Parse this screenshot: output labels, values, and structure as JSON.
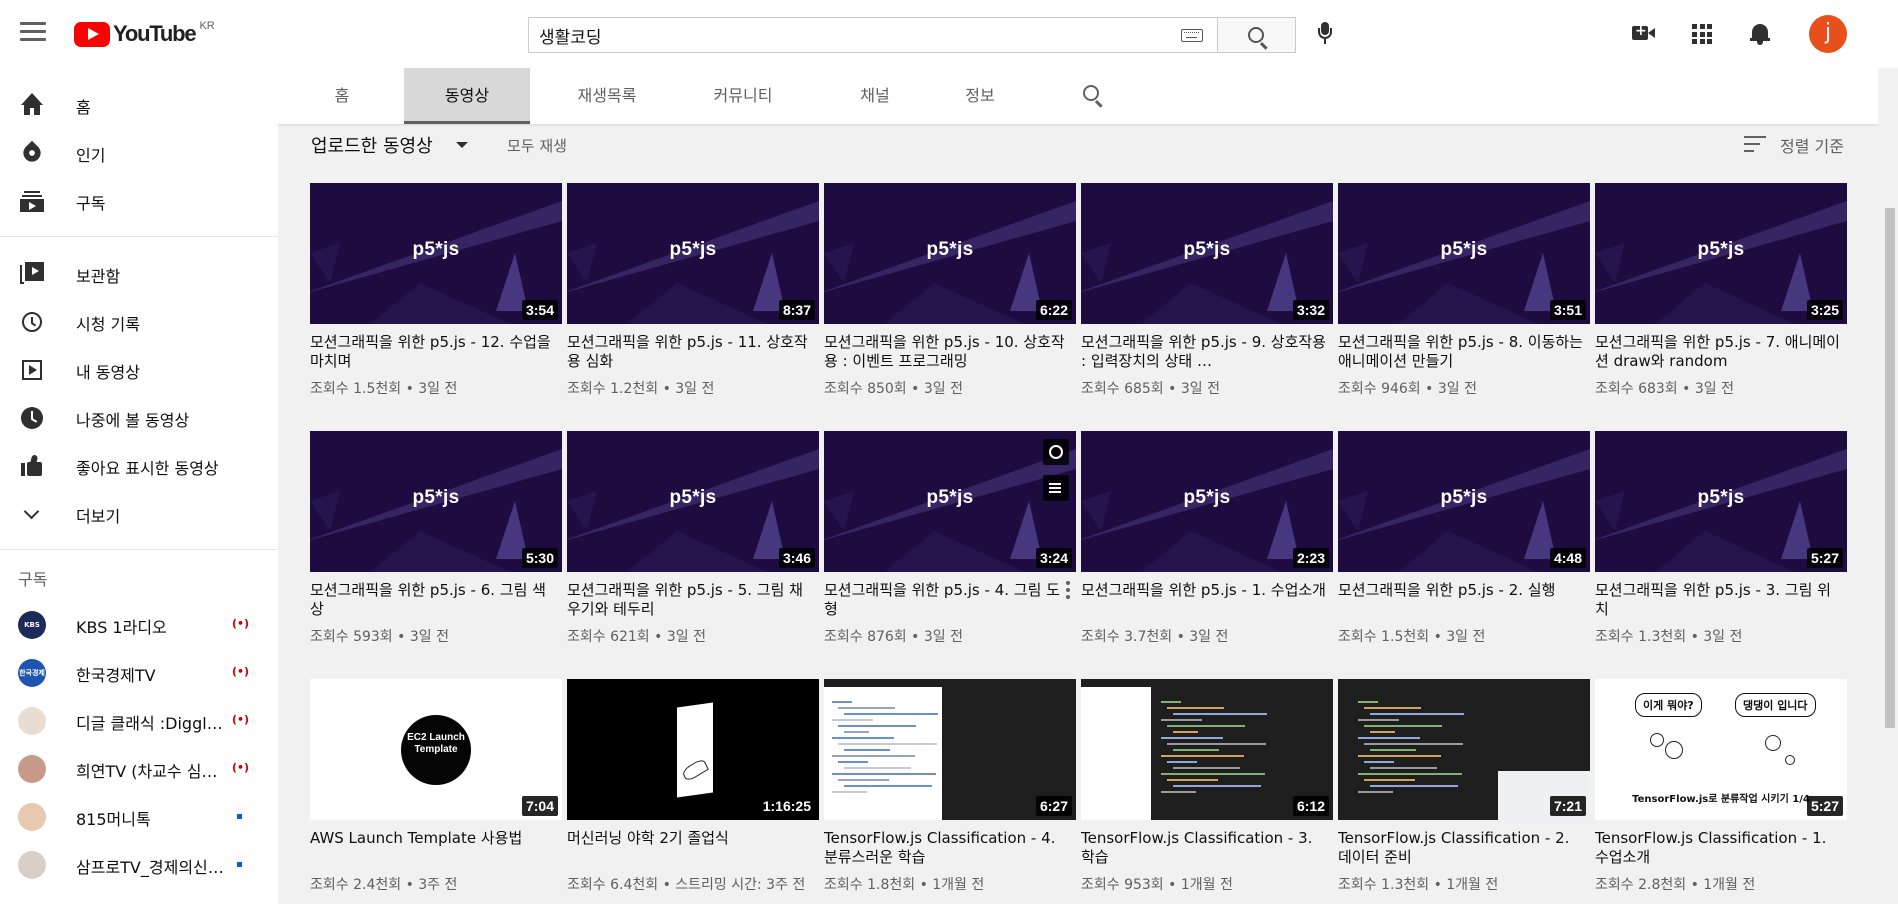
{
  "header": {
    "logo_text": "YouTube",
    "region": "KR",
    "search_value": "생활코딩",
    "avatar_letter": "j"
  },
  "sidebar": {
    "items": [
      {
        "label": "홈",
        "icon": "home-icon"
      },
      {
        "label": "인기",
        "icon": "trending-icon"
      },
      {
        "label": "구독",
        "icon": "subscriptions-icon"
      }
    ],
    "library_items": [
      {
        "label": "보관함",
        "icon": "library-icon"
      },
      {
        "label": "시청 기록",
        "icon": "history-icon"
      },
      {
        "label": "내 동영상",
        "icon": "my-videos-icon"
      },
      {
        "label": "나중에 볼 동영상",
        "icon": "watch-later-icon"
      },
      {
        "label": "좋아요 표시한 동영상",
        "icon": "liked-videos-icon"
      },
      {
        "label": "더보기",
        "icon": "chevron-down-icon"
      }
    ],
    "subscriptions_title": "구독",
    "subscriptions": [
      {
        "name": "KBS 1라디오",
        "status": "live",
        "avatar_color": "#1c2a5a",
        "avatar_text": "KBS 1R"
      },
      {
        "name": "한국경제TV",
        "status": "live",
        "avatar_color": "#1f55b0",
        "avatar_text": "한국경제TV"
      },
      {
        "name": "디글 클래식 :Diggle Classic",
        "status": "live",
        "avatar_color": "#e9ddd2",
        "avatar_text": ""
      },
      {
        "name": "희연TV (차교수 심리학)",
        "status": "live",
        "avatar_color": "#c79a8a",
        "avatar_text": ""
      },
      {
        "name": "815머니톡",
        "status": "new",
        "avatar_color": "#e7c8b0",
        "avatar_text": ""
      },
      {
        "name": "삼프로TV_경제의신과함께",
        "status": "new",
        "avatar_color": "#d8d0c8",
        "avatar_text": ""
      }
    ],
    "live_glyph": "(•)"
  },
  "tabs": [
    {
      "label": "홈"
    },
    {
      "label": "동영상"
    },
    {
      "label": "재생목록"
    },
    {
      "label": "커뮤니티"
    },
    {
      "label": "채널"
    },
    {
      "label": "정보"
    }
  ],
  "uploads": {
    "title": "업로드한 동영상",
    "play_all": "모두 재생",
    "sort_label": "정렬 기준"
  },
  "videos": [
    {
      "title": "모션그래픽을 위한 p5.js - 12. 수업을 마치며",
      "meta": "조회수 1.5천회 • 3일 전",
      "duration": "3:54",
      "thumb": "p5"
    },
    {
      "title": "모션그래픽을 위한 p5.js - 11. 상호작용 심화",
      "meta": "조회수 1.2천회 • 3일 전",
      "duration": "8:37",
      "thumb": "p5"
    },
    {
      "title": "모션그래픽을 위한 p5.js - 10. 상호작용 : 이벤트 프로그래밍",
      "meta": "조회수 850회 • 3일 전",
      "duration": "6:22",
      "thumb": "p5"
    },
    {
      "title": "모션그래픽을 위한 p5.js - 9. 상호작용 : 입력장치의 상태 …",
      "meta": "조회수 685회 • 3일 전",
      "duration": "3:32",
      "thumb": "p5"
    },
    {
      "title": "모션그래픽을 위한 p5.js - 8. 이동하는 애니메이션 만들기",
      "meta": "조회수 946회 • 3일 전",
      "duration": "3:51",
      "thumb": "p5"
    },
    {
      "title": "모션그래픽을 위한 p5.js - 7. 애니메이션 draw와 random",
      "meta": "조회수 683회 • 3일 전",
      "duration": "3:25",
      "thumb": "p5"
    },
    {
      "title": "모션그래픽을 위한 p5.js - 6. 그림 색상",
      "meta": "조회수 593회 • 3일 전",
      "duration": "5:30",
      "thumb": "p5"
    },
    {
      "title": "모션그래픽을 위한 p5.js - 5. 그림 채우기와 테두리",
      "meta": "조회수 621회 • 3일 전",
      "duration": "3:46",
      "thumb": "p5"
    },
    {
      "title": "모션그래픽을 위한 p5.js - 4. 그림 도형",
      "meta": "조회수 876회 • 3일 전",
      "duration": "3:24",
      "thumb": "p5",
      "hovered": true
    },
    {
      "title": "모션그래픽을 위한 p5.js - 1. 수업소개",
      "meta": "조회수 3.7천회 • 3일 전",
      "duration": "2:23",
      "thumb": "p5"
    },
    {
      "title": "모션그래픽을 위한 p5.js - 2. 실행",
      "meta": "조회수 1.5천회 • 3일 전",
      "duration": "4:48",
      "thumb": "p5"
    },
    {
      "title": "모션그래픽을 위한 p5.js - 3. 그림 위치",
      "meta": "조회수 1.3천회 • 3일 전",
      "duration": "5:27",
      "thumb": "p5"
    },
    {
      "title": "AWS Launch Template 사용법",
      "meta": "조회수 2.4천회 • 3주 전",
      "duration": "7:04",
      "thumb": "ec2"
    },
    {
      "title": "머신러닝 야학 2기 졸업식",
      "meta": "조회수 6.4천회 • 스트리밍 시간: 3주 전",
      "duration": "1:16:25",
      "thumb": "ml"
    },
    {
      "title": "TensorFlow.js Classification - 4. 분류스러운 학습",
      "meta": "조회수 1.8천회 • 1개월 전",
      "duration": "6:27",
      "thumb": "code1"
    },
    {
      "title": "TensorFlow.js Classification - 3. 학습",
      "meta": "조회수 953회 • 1개월 전",
      "duration": "6:12",
      "thumb": "code2"
    },
    {
      "title": "TensorFlow.js Classification - 2. 데이터 준비",
      "meta": "조회수 1.3천회 • 1개월 전",
      "duration": "7:21",
      "thumb": "code3"
    },
    {
      "title": "TensorFlow.js Classification - 1. 수업소개",
      "meta": "조회수 2.8천회 • 1개월 전",
      "duration": "5:27",
      "thumb": "tf"
    }
  ],
  "thumb_text": {
    "p5_logo": "p5*js",
    "ec2": "EC2 Launch Template",
    "tf_bubble_1": "이게 뭐야?",
    "tf_bubble_2": "댕댕이 입니다",
    "tf_caption": "TensorFlow.js로 분류작업 시키기 1/4"
  },
  "colors": {
    "brand_red": "#ff0000",
    "p5_bg": "#1e0b40",
    "avatar": "#e8501b"
  }
}
